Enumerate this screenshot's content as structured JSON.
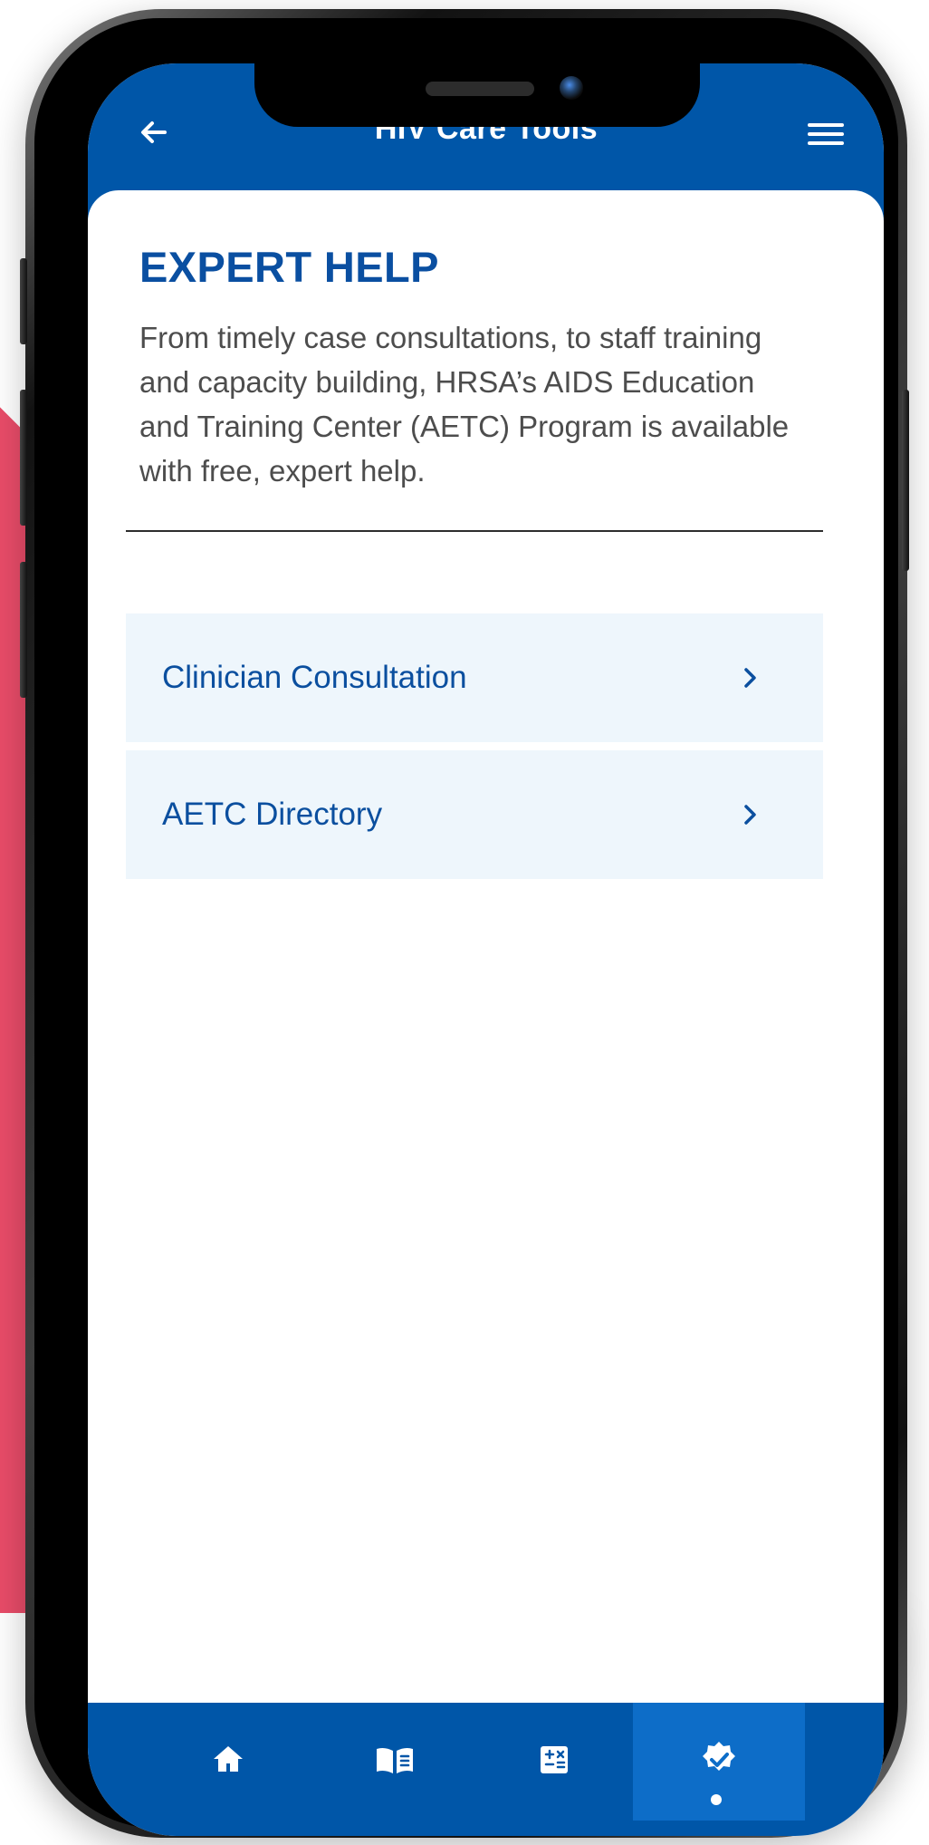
{
  "header": {
    "title": "HIV Care Tools"
  },
  "content": {
    "section_title": "EXPERT HELP",
    "description": "From timely case consultations, to staff training and capacity building, HRSA’s AIDS Education and Training Center (AETC) Program is available with free, expert help."
  },
  "links": {
    "items": [
      {
        "label": "Clinician Consultation",
        "icon": "chevron-right-icon"
      },
      {
        "label": "AETC Directory",
        "icon": "chevron-right-icon"
      }
    ]
  },
  "bottom_nav": {
    "items": [
      {
        "icon": "home-icon"
      },
      {
        "icon": "book-icon"
      },
      {
        "icon": "calculator-icon"
      },
      {
        "icon": "verified-badge-icon",
        "active": true
      }
    ]
  },
  "colors": {
    "brand_blue": "#0056a8",
    "active_nav": "#0d6dc8",
    "link_background": "#eef6fc",
    "heading_blue": "#0a4fa1",
    "body_text": "#4d4d4d",
    "accent_pink": "#e94c69"
  }
}
